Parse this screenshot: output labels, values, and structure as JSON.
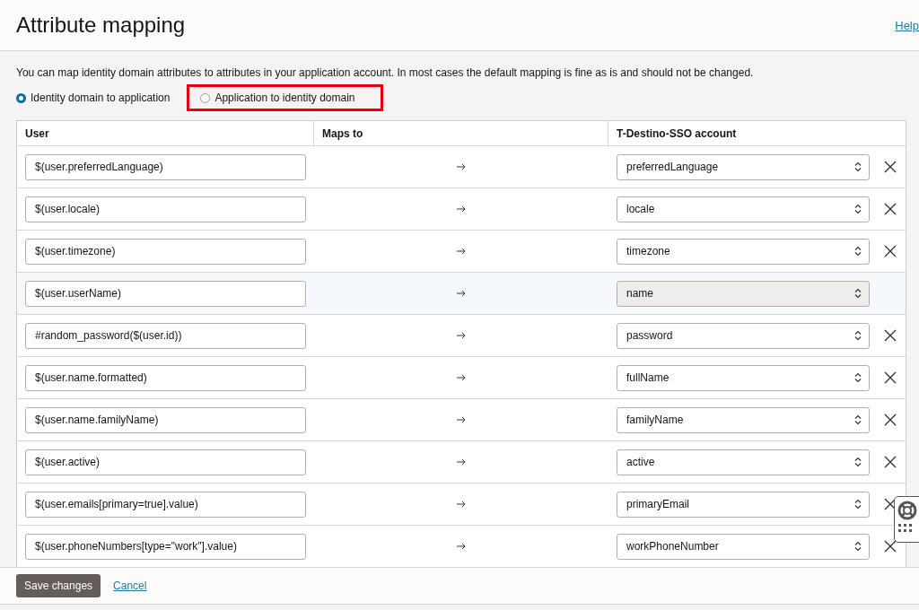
{
  "header": {
    "title": "Attribute mapping",
    "help_link": "Help"
  },
  "description": "You can map identity domain attributes to attributes in your application account. In most cases the default mapping is fine as is and should not be changed.",
  "direction_options": [
    {
      "label": "Identity domain to application",
      "selected": true,
      "highlighted": false
    },
    {
      "label": "Application to identity domain",
      "selected": false,
      "highlighted": true
    }
  ],
  "table": {
    "columns": [
      "User",
      "Maps to",
      "T-Destino-SSO account"
    ],
    "rows": [
      {
        "source": "$(user.preferredLanguage)",
        "target": "preferredLanguage",
        "disabled": false,
        "removable": true
      },
      {
        "source": "$(user.locale)",
        "target": "locale",
        "disabled": false,
        "removable": true
      },
      {
        "source": "$(user.timezone)",
        "target": "timezone",
        "disabled": false,
        "removable": true
      },
      {
        "source": "$(user.userName)",
        "target": "name",
        "disabled": true,
        "removable": false
      },
      {
        "source": "#random_password($(user.id))",
        "target": "password",
        "disabled": false,
        "removable": true
      },
      {
        "source": "$(user.name.formatted)",
        "target": "fullName",
        "disabled": false,
        "removable": true
      },
      {
        "source": "$(user.name.familyName)",
        "target": "familyName",
        "disabled": false,
        "removable": true
      },
      {
        "source": "$(user.active)",
        "target": "active",
        "disabled": false,
        "removable": true
      },
      {
        "source": "$(user.emails[primary=true].value)",
        "target": "primaryEmail",
        "disabled": false,
        "removable": true
      },
      {
        "source": "$(user.phoneNumbers[type=\"work\"].value)",
        "target": "workPhoneNumber",
        "disabled": false,
        "removable": true
      }
    ]
  },
  "footer": {
    "save_button": "Save changes",
    "cancel_link": "Cancel"
  }
}
